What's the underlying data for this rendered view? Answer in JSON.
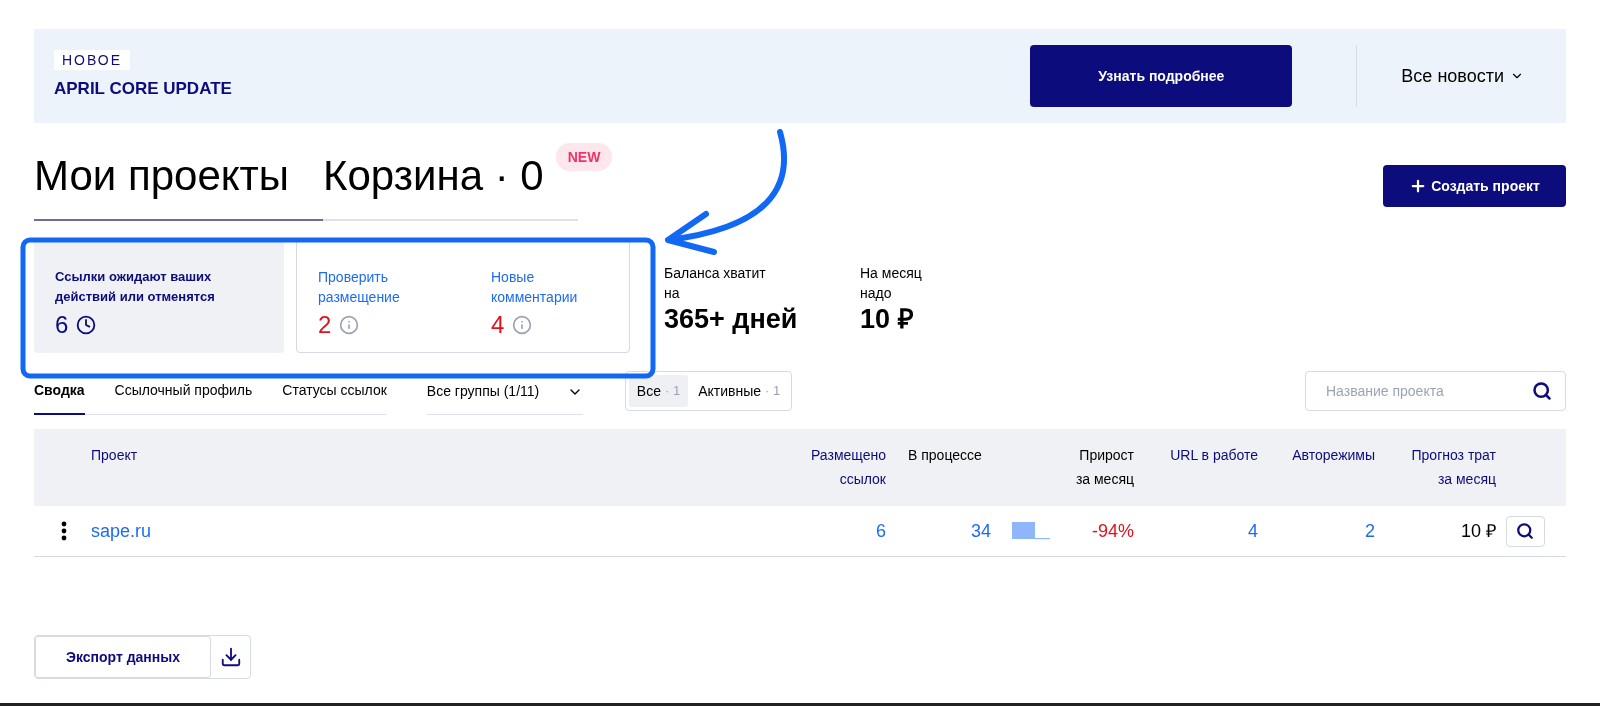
{
  "banner": {
    "badge": "НОВОЕ",
    "title": "APRIL CORE UPDATE",
    "button": "Узнать подробнее",
    "news": "Все новости"
  },
  "header": {
    "tabs": [
      {
        "label": "Мои проекты",
        "selected": true
      },
      {
        "label": "Корзина · 0",
        "selected": false
      }
    ],
    "new_badge": "NEW",
    "create_button": "Создать проект"
  },
  "cards": {
    "pending": {
      "title": "Ссылки ожидают ваших действий или отменятся",
      "count": "6"
    },
    "alerts": [
      {
        "label": "Проверить размещение",
        "count": "2"
      },
      {
        "label": "Новые комментарии",
        "count": "4"
      }
    ]
  },
  "stats": [
    {
      "label": "Баланса хватит на",
      "value": "365+ дней"
    },
    {
      "label": "На месяц надо",
      "value": "10 ₽"
    }
  ],
  "view_tabs": [
    {
      "label": "Сводка",
      "selected": true
    },
    {
      "label": "Ссылочный профиль",
      "selected": false
    },
    {
      "label": "Статусы ссылок",
      "selected": false
    }
  ],
  "group_select": "Все группы (1/11)",
  "filters": [
    {
      "label": "Все",
      "count": "· 1",
      "selected": true
    },
    {
      "label": "Активные",
      "count": "· 1",
      "selected": false
    }
  ],
  "search": {
    "placeholder": "Название проекта"
  },
  "table": {
    "columns": [
      {
        "label": "Проект",
        "kind": "sortable"
      },
      {
        "label": "Размещено ссылок",
        "kind": "sortable"
      },
      {
        "label": "В процессе",
        "kind": "plain"
      },
      {
        "label": "Прирост за месяц",
        "kind": "plain"
      },
      {
        "label": "URL в работе",
        "kind": "sortable"
      },
      {
        "label": "Авторежимы",
        "kind": "sortable"
      },
      {
        "label": "Прогноз трат за месяц",
        "kind": "sortable"
      }
    ],
    "rows": [
      {
        "project": "sape.ru",
        "placed": "6",
        "in_progress": "34",
        "growth": "-94%",
        "urls": "4",
        "auto": "2",
        "forecast": "10 ₽"
      }
    ]
  },
  "export_button": "Экспорт данных"
}
